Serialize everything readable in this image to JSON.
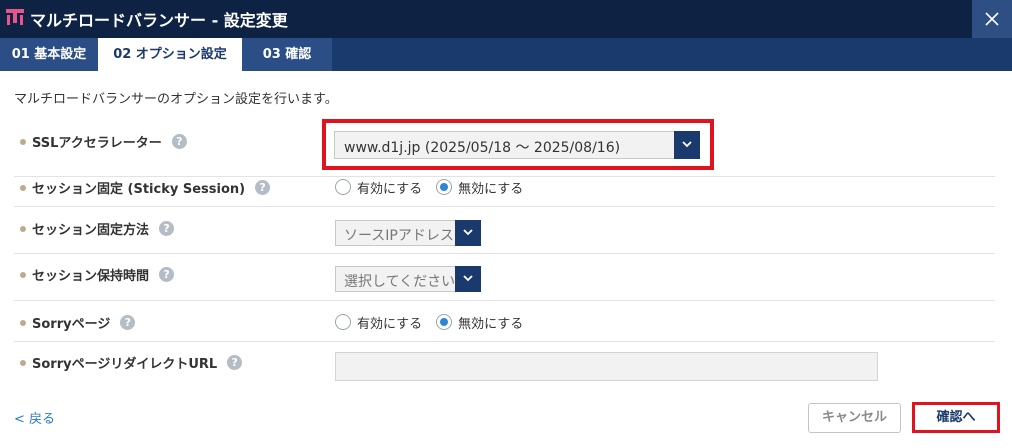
{
  "window": {
    "title": "マルチロードバランサー - 設定変更",
    "close_label": "×"
  },
  "tabs": [
    {
      "label": "01 基本設定",
      "active": false
    },
    {
      "label": "02 オプション設定",
      "active": true
    },
    {
      "label": "03 確認",
      "active": false
    }
  ],
  "intro": "マルチロードバランサーのオプション設定を行います。",
  "help_glyph": "?",
  "rows": {
    "ssl": {
      "label": "SSLアクセラレーター",
      "value": "www.d1j.jp (2025/05/18 ～ 2025/08/16)"
    },
    "sticky": {
      "label": "セッション固定 (Sticky Session)",
      "options": [
        "有効にする",
        "無効にする"
      ],
      "selected": "無効にする"
    },
    "method": {
      "label": "セッション固定方法",
      "value": "ソースIPアドレス"
    },
    "timeout": {
      "label": "セッション保持時間",
      "value": "選択してください"
    },
    "sorry": {
      "label": "Sorryページ",
      "options": [
        "有効にする",
        "無効にする"
      ],
      "selected": "無効にする"
    },
    "redirect": {
      "label": "SorryページリダイレクトURL",
      "value": ""
    }
  },
  "footer": {
    "back_label": "< 戻る",
    "cancel_label": "キャンセル",
    "confirm_label": "確認へ"
  },
  "colors": {
    "titlebar": "#0e2344",
    "tabbar": "#1a3a6e",
    "accent_blue": "#2f86d6",
    "highlight_red": "#e0141e"
  }
}
